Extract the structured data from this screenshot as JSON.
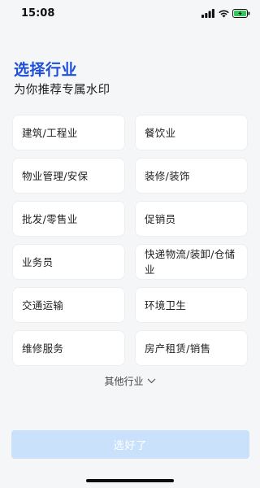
{
  "status": {
    "time": "15:08",
    "signal_icon": "signal-bars-icon",
    "wifi_icon": "wifi-icon",
    "battery_icon": "battery-charging-icon",
    "battery_color": "#34c759"
  },
  "header": {
    "title": "选择行业",
    "subtitle": "为你推荐专属水印",
    "title_color": "#1f4fd6"
  },
  "industries": [
    "建筑/工程业",
    "餐饮业",
    "物业管理/安保",
    "装修/装饰",
    "批发/零售业",
    "促销员",
    "业务员",
    "快递物流/装卸/仓储业",
    "交通运输",
    "环境卫生",
    "维修服务",
    "房产租赁/销售"
  ],
  "more": {
    "label": "其他行业",
    "icon": "chevron-down-icon"
  },
  "confirm": {
    "label": "选好了",
    "color": "#c9e1fb"
  }
}
